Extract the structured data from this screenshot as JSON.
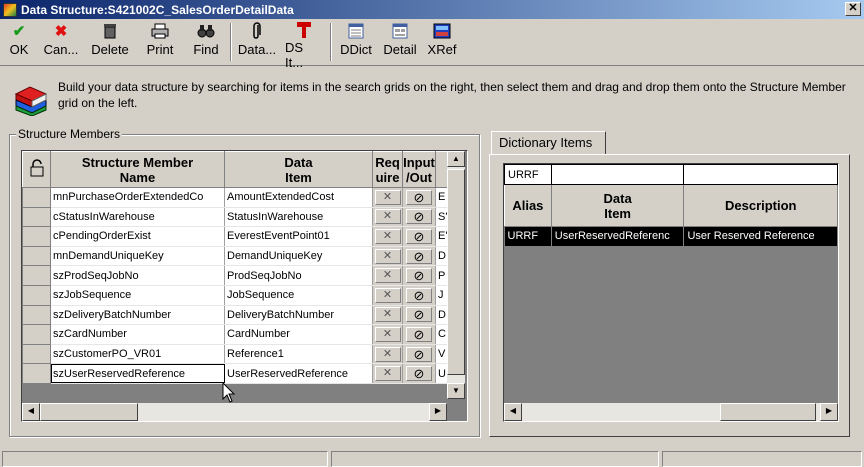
{
  "window": {
    "title": "Data Structure:S421002C_SalesOrderDetailData",
    "close_glyph": "✕"
  },
  "toolbar": [
    {
      "label": "OK",
      "icon": "checkmark-icon",
      "glyph": "✔",
      "color": "#1a9a1a"
    },
    {
      "label": "Can...",
      "icon": "cancel-x-icon",
      "glyph": "✖",
      "color": "#e01010"
    },
    {
      "label": "Delete",
      "icon": "trash-icon",
      "glyph": "🗑",
      "color": "#000000"
    },
    {
      "label": "Print",
      "icon": "printer-icon",
      "glyph": "🖶",
      "color": "#000000"
    },
    {
      "label": "Find",
      "icon": "binoculars-icon",
      "glyph": "⚲",
      "color": "#000000"
    },
    {
      "label": "Data...",
      "icon": "paperclip-icon",
      "glyph": "📎",
      "color": "#000000"
    },
    {
      "label": "DS It...",
      "icon": "red-t-icon",
      "glyph": "T",
      "color": "#cc0000"
    },
    {
      "label": "DDict",
      "icon": "dictionary-icon",
      "glyph": "▦",
      "color": "#4060a0"
    },
    {
      "label": "Detail",
      "icon": "detail-icon",
      "glyph": "▤",
      "color": "#4060a0"
    },
    {
      "label": "XRef",
      "icon": "xref-icon",
      "glyph": "▬",
      "color": "#2040c0"
    }
  ],
  "info": {
    "text": "Build your data structure by searching for items in the search grids on the right, then select them and drag and drop them onto the Structure Member grid on the left.",
    "icon": "books-stack-icon"
  },
  "structure_members": {
    "group_label": "Structure Members",
    "columns": {
      "name": "Structure Member\nName",
      "item": "Data\nItem",
      "required": "Req\nuire",
      "inout": "Input\n/Out"
    },
    "rows": [
      {
        "name": "mnPurchaseOrderExtendedCo",
        "item": "AmountExtendedCost",
        "extra": "E"
      },
      {
        "name": "cStatusInWarehouse",
        "item": "StatusInWarehouse",
        "extra": "S'"
      },
      {
        "name": "cPendingOrderExist",
        "item": "EverestEventPoint01",
        "extra": "E'"
      },
      {
        "name": "mnDemandUniqueKey",
        "item": "DemandUniqueKey",
        "extra": "D"
      },
      {
        "name": "szProdSeqJobNo",
        "item": "ProdSeqJobNo",
        "extra": "P"
      },
      {
        "name": "szJobSequence",
        "item": "JobSequence",
        "extra": "J"
      },
      {
        "name": "szDeliveryBatchNumber",
        "item": "DeliveryBatchNumber",
        "extra": "D"
      },
      {
        "name": "szCardNumber",
        "item": "CardNumber",
        "extra": "C."
      },
      {
        "name": "szCustomerPO_VR01",
        "item": "Reference1",
        "extra": "V"
      },
      {
        "name": "szUserReservedReference",
        "item": "UserReservedReference",
        "extra": "U"
      }
    ],
    "required_glyph": "✕",
    "inout_glyph": "⊘"
  },
  "dictionary": {
    "tab_label": "Dictionary Items",
    "filter": {
      "alias": "URRF",
      "data_item": "",
      "description": ""
    },
    "columns": {
      "alias": "Alias",
      "data_item": "Data\nItem",
      "description": "Description"
    },
    "rows": [
      {
        "alias": "URRF",
        "data_item": "UserReservedReferenc",
        "description": "User Reserved Reference"
      }
    ]
  }
}
